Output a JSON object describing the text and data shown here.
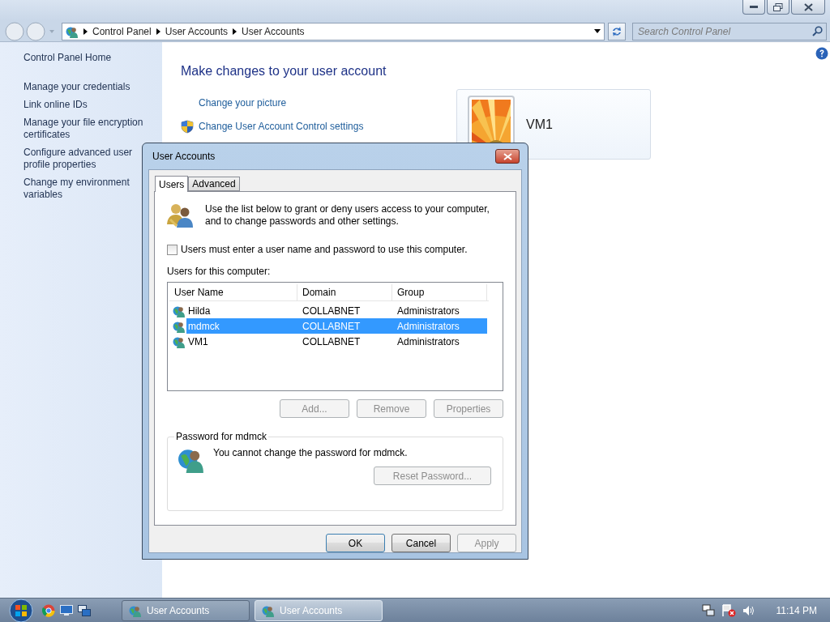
{
  "address_bar": {
    "crumbs": [
      "Control Panel",
      "User Accounts",
      "User Accounts"
    ]
  },
  "search": {
    "placeholder": "Search Control Panel"
  },
  "sidebar": {
    "home": "Control Panel Home",
    "links": [
      "Manage your credentials",
      "Link online IDs",
      "Manage your file encryption certificates",
      "Configure advanced user profile properties",
      "Change my environment variables"
    ]
  },
  "main": {
    "heading": "Make changes to your user account",
    "links": [
      {
        "label": "Change your picture",
        "kind": "plain"
      },
      {
        "label": "Change User Account Control settings",
        "kind": "shield"
      }
    ]
  },
  "account_card": {
    "name": "VM1"
  },
  "dialog": {
    "title": "User Accounts",
    "tabs": [
      {
        "label": "Users",
        "selected": true
      },
      {
        "label": "Advanced",
        "selected": false
      }
    ],
    "intro": "Use the list below to grant or deny users access to your computer, and to change passwords and other settings.",
    "require_password": {
      "label": "Users must enter a user name and password to use this computer.",
      "checked": false
    },
    "list_label": "Users for this computer:",
    "columns": [
      "User Name",
      "Domain",
      "Group"
    ],
    "rows": [
      {
        "name": "Hilda",
        "domain": "COLLABNET",
        "group": "Administrators",
        "selected": false
      },
      {
        "name": "mdmck",
        "domain": "COLLABNET",
        "group": "Administrators",
        "selected": true
      },
      {
        "name": "VM1",
        "domain": "COLLABNET",
        "group": "Administrators",
        "selected": false
      }
    ],
    "list_buttons": [
      {
        "label": "Add...",
        "disabled": true
      },
      {
        "label": "Remove",
        "disabled": true
      },
      {
        "label": "Properties",
        "disabled": true
      }
    ],
    "password_group": {
      "title": "Password for mdmck",
      "message": "You cannot change the password for mdmck.",
      "button": {
        "label": "Reset Password...",
        "disabled": true
      }
    },
    "buttons": [
      {
        "label": "OK",
        "disabled": false
      },
      {
        "label": "Cancel",
        "disabled": false
      },
      {
        "label": "Apply",
        "disabled": true
      }
    ]
  },
  "taskbar": {
    "tasks": [
      {
        "label": "User Accounts",
        "selected": false
      },
      {
        "label": "User Accounts",
        "selected": true
      }
    ],
    "clock": "11:14 PM"
  }
}
